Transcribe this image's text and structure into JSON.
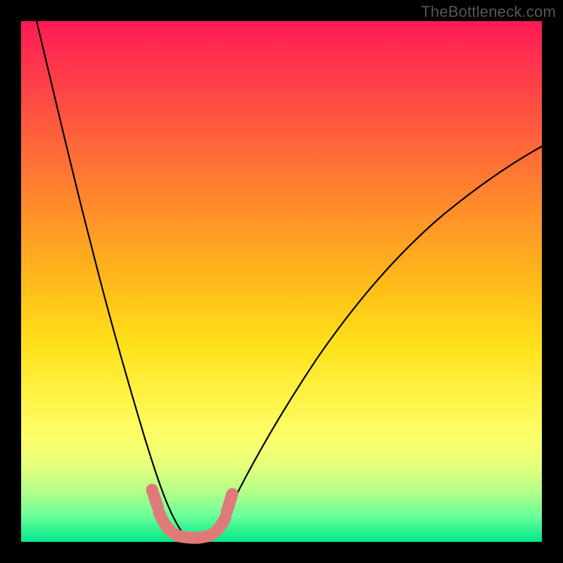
{
  "watermark": "TheBottleneck.com",
  "colors": {
    "frame": "#000000",
    "gradient_top": "#ff1a55",
    "gradient_bottom": "#00e88a",
    "curve": "#000000",
    "bump": "#e07a78"
  },
  "chart_data": {
    "type": "line",
    "title": "",
    "xlabel": "",
    "ylabel": "",
    "xlim": [
      0,
      1
    ],
    "ylim": [
      0,
      1
    ],
    "curve_black": {
      "description": "smooth V-shaped bottleneck curve; minimum near x≈0.32 at y≈0, steep left arm from top-left, shallower right arm rising to ~0.76 at right edge",
      "x": [
        0.03,
        0.06,
        0.1,
        0.14,
        0.18,
        0.22,
        0.26,
        0.28,
        0.3,
        0.32,
        0.34,
        0.36,
        0.38,
        0.42,
        0.48,
        0.55,
        0.63,
        0.72,
        0.82,
        0.91,
        1.0
      ],
      "y": [
        1.0,
        0.86,
        0.7,
        0.55,
        0.41,
        0.28,
        0.14,
        0.08,
        0.04,
        0.02,
        0.02,
        0.04,
        0.08,
        0.16,
        0.26,
        0.36,
        0.46,
        0.55,
        0.64,
        0.71,
        0.76
      ]
    },
    "bump_pink": {
      "description": "thick rounded salmon segment at trough, ~x 0.26–0.40, y 0.00–0.10, with small raised lobes at each end",
      "x": [
        0.255,
        0.265,
        0.28,
        0.3,
        0.32,
        0.34,
        0.36,
        0.38,
        0.395,
        0.405
      ],
      "y": [
        0.095,
        0.065,
        0.02,
        0.01,
        0.005,
        0.005,
        0.01,
        0.03,
        0.075,
        0.105
      ]
    }
  }
}
